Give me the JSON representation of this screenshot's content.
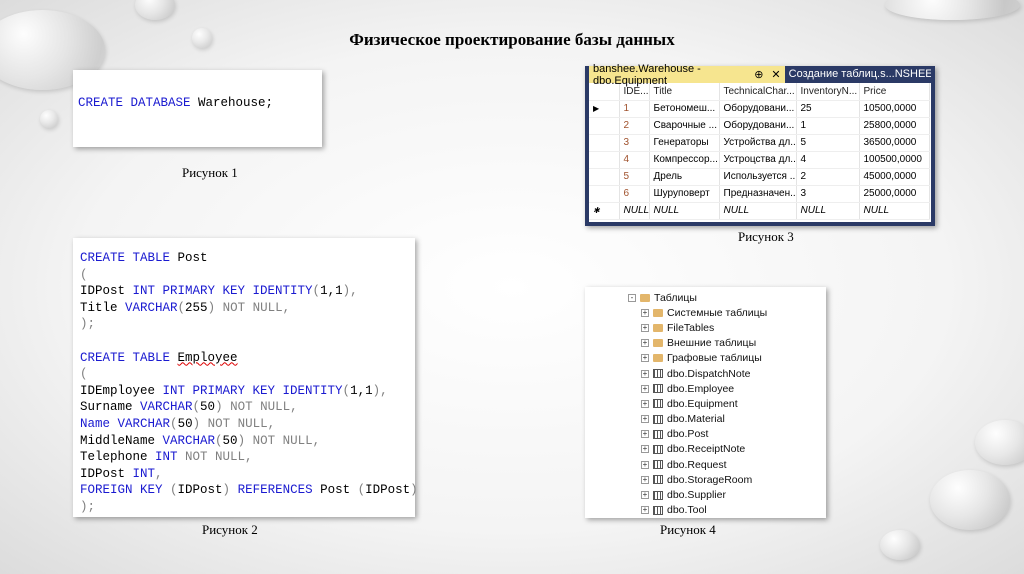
{
  "title": "Физическое проектирование базы данных",
  "captions": {
    "fig1": "Рисунок 1",
    "fig2": "Рисунок 2",
    "fig3": "Рисунок 3",
    "fig4": "Рисунок 4"
  },
  "fig1": {
    "code": [
      [
        [
          "CREATE DATABASE",
          "kw"
        ],
        [
          " Warehouse;",
          ""
        ]
      ]
    ]
  },
  "fig2": {
    "code": [
      [
        [
          "CREATE TABLE",
          "kw"
        ],
        [
          " Post",
          ""
        ]
      ],
      [
        [
          "(",
          "gr"
        ]
      ],
      [
        [
          "IDPost ",
          ""
        ],
        [
          "INT PRIMARY KEY IDENTITY",
          "kw"
        ],
        [
          "(",
          "gr"
        ],
        [
          "1,1",
          ""
        ],
        [
          "),",
          "gr"
        ]
      ],
      [
        [
          "Title ",
          ""
        ],
        [
          "VARCHAR",
          "kw"
        ],
        [
          "(",
          "gr"
        ],
        [
          "255",
          ""
        ],
        [
          ")",
          "gr"
        ],
        [
          " NOT NULL,",
          "gr"
        ]
      ],
      [
        [
          ");",
          "gr"
        ]
      ],
      [
        [
          "",
          ""
        ]
      ],
      [
        [
          "CREATE TABLE",
          "kw"
        ],
        [
          " ",
          ""
        ],
        [
          "Employee",
          "sq"
        ]
      ],
      [
        [
          "(",
          "gr"
        ]
      ],
      [
        [
          "IDEmployee ",
          ""
        ],
        [
          "INT PRIMARY KEY IDENTITY",
          "kw"
        ],
        [
          "(",
          "gr"
        ],
        [
          "1,1",
          ""
        ],
        [
          "),",
          "gr"
        ]
      ],
      [
        [
          "Surname ",
          ""
        ],
        [
          "VARCHAR",
          "kw"
        ],
        [
          "(",
          "gr"
        ],
        [
          "50",
          ""
        ],
        [
          ")",
          "gr"
        ],
        [
          " NOT NULL,",
          "gr"
        ]
      ],
      [
        [
          "Name",
          "kw"
        ],
        [
          " ",
          ""
        ],
        [
          "VARCHAR",
          "kw"
        ],
        [
          "(",
          "gr"
        ],
        [
          "50",
          ""
        ],
        [
          ")",
          "gr"
        ],
        [
          " NOT NULL,",
          "gr"
        ]
      ],
      [
        [
          "MiddleName ",
          ""
        ],
        [
          "VARCHAR",
          "kw"
        ],
        [
          "(",
          "gr"
        ],
        [
          "50",
          ""
        ],
        [
          ")",
          "gr"
        ],
        [
          " NOT NULL,",
          "gr"
        ]
      ],
      [
        [
          "Telephone ",
          ""
        ],
        [
          "INT",
          "kw"
        ],
        [
          " NOT NULL,",
          "gr"
        ]
      ],
      [
        [
          "IDPost ",
          ""
        ],
        [
          "INT",
          "kw"
        ],
        [
          ",",
          "gr"
        ]
      ],
      [
        [
          "FOREIGN KEY",
          "kw"
        ],
        [
          " (",
          "gr"
        ],
        [
          "IDPost",
          ""
        ],
        [
          ")",
          "gr"
        ],
        [
          " REFERENCES",
          "kw"
        ],
        [
          " Post ",
          ""
        ],
        [
          "(",
          "gr"
        ],
        [
          "IDPost",
          ""
        ],
        [
          ")",
          "gr"
        ]
      ],
      [
        [
          ");",
          "gr"
        ]
      ]
    ]
  },
  "fig3": {
    "tab_active": "banshee.Warehouse - dbo.Equipment",
    "tab_pin": "⊕",
    "tab_close": "✕",
    "tab_other": "Создание таблиц.s...NSHEE\\ost",
    "columns": [
      "IDE...",
      "Title",
      "TechnicalChar...",
      "InventoryN...",
      "Price"
    ],
    "rows": [
      [
        "1",
        "Бетономеш...",
        "Оборудовани...",
        "25",
        "10500,0000"
      ],
      [
        "2",
        "Сварочные ...",
        "Оборудовани...",
        "1",
        "25800,0000"
      ],
      [
        "3",
        "Генераторы",
        "Устройства дл...",
        "5",
        "36500,0000"
      ],
      [
        "4",
        "Компрессор...",
        "Устроцства дл...",
        "4",
        "100500,0000"
      ],
      [
        "5",
        "Дрель",
        "Используется ...",
        "2",
        "45000,0000"
      ],
      [
        "6",
        "Шуруповерт",
        "Предназначен...",
        "3",
        "25000,0000"
      ],
      [
        "NULL",
        "NULL",
        "NULL",
        "NULL",
        "NULL"
      ]
    ],
    "row_markers": [
      "▶",
      "",
      "",
      "",
      "",
      "",
      "✱"
    ]
  },
  "fig4": {
    "root": "Таблицы",
    "folders": [
      "Системные таблицы",
      "FileTables",
      "Внешние таблицы",
      "Графовые таблицы"
    ],
    "tables": [
      "dbo.DispatchNote",
      "dbo.Employee",
      "dbo.Equipment",
      "dbo.Material",
      "dbo.Post",
      "dbo.ReceiptNote",
      "dbo.Request",
      "dbo.StorageRoom",
      "dbo.Supplier",
      "dbo.Tool"
    ]
  }
}
